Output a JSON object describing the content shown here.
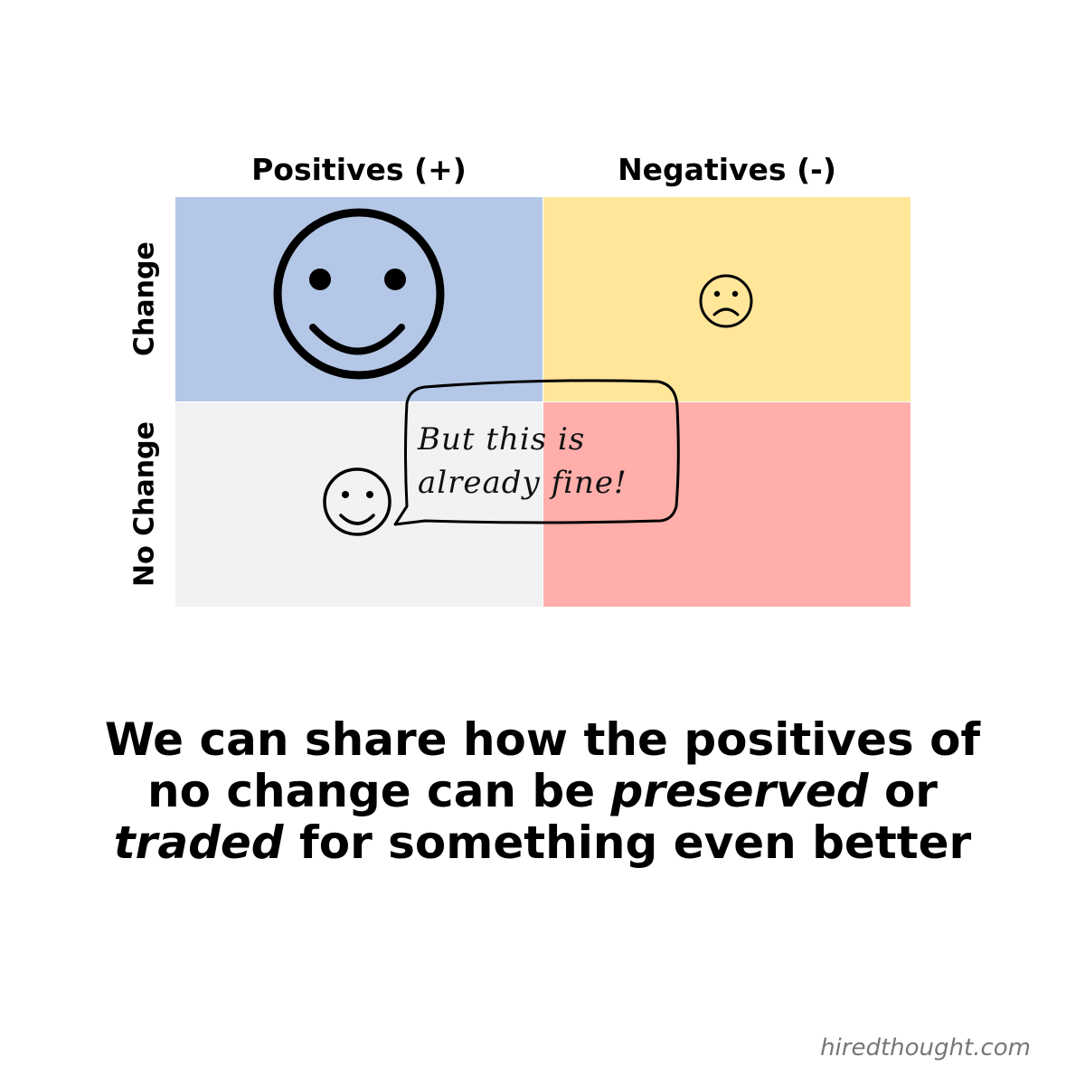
{
  "columns": {
    "positives": "Positives (+)",
    "negatives": "Negatives (-)"
  },
  "rows": {
    "change": "Change",
    "no_change": "No Change"
  },
  "colors": {
    "positive_change": "#b4c7e7",
    "negative_change": "#ffe699",
    "positive_no_change": "#f2f2f2",
    "negative_no_change": "#ffaeab"
  },
  "icons": {
    "positive_change": "large-smiley-icon",
    "negative_change": "frowning-face-icon",
    "positive_no_change": "small-smiley-icon"
  },
  "speech_bubble": {
    "line1": "But this is",
    "line2": "already fine!"
  },
  "caption": {
    "part1": "We can share how the positives of no change can be ",
    "em1": "preserved",
    "part2": " or ",
    "em2": "traded",
    "part3": " for something even better"
  },
  "credit": "hiredthought.com"
}
